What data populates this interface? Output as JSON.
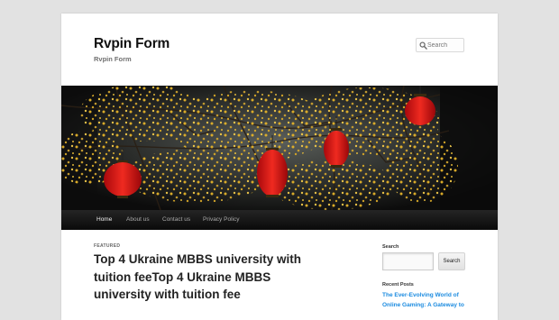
{
  "header": {
    "site_title": "Rvpin Form",
    "site_description": "Rvpin Form",
    "search_placeholder": "Search"
  },
  "nav": {
    "items": [
      {
        "label": "Home",
        "active": true
      },
      {
        "label": "About us",
        "active": false
      },
      {
        "label": "Contact us",
        "active": false
      },
      {
        "label": "Privacy Policy",
        "active": false
      }
    ]
  },
  "main": {
    "featured_label": "FEATURED",
    "post_title": "Top 4 Ukraine MBBS university with tuition feeTop 4 Ukraine MBBS university with tuition fee"
  },
  "sidebar": {
    "search_widget_title": "Search",
    "search_button_label": "Search",
    "recent_posts_title": "Recent Posts",
    "recent_posts": [
      "The Ever-Evolving World of",
      "Online Gaming: A Gateway to"
    ]
  },
  "colors": {
    "link": "#1b8be0",
    "nav_background": "#111111",
    "page_background": "#e2e2e2",
    "lantern_red": "#e8171b"
  },
  "icons": {
    "search": "search-icon"
  }
}
